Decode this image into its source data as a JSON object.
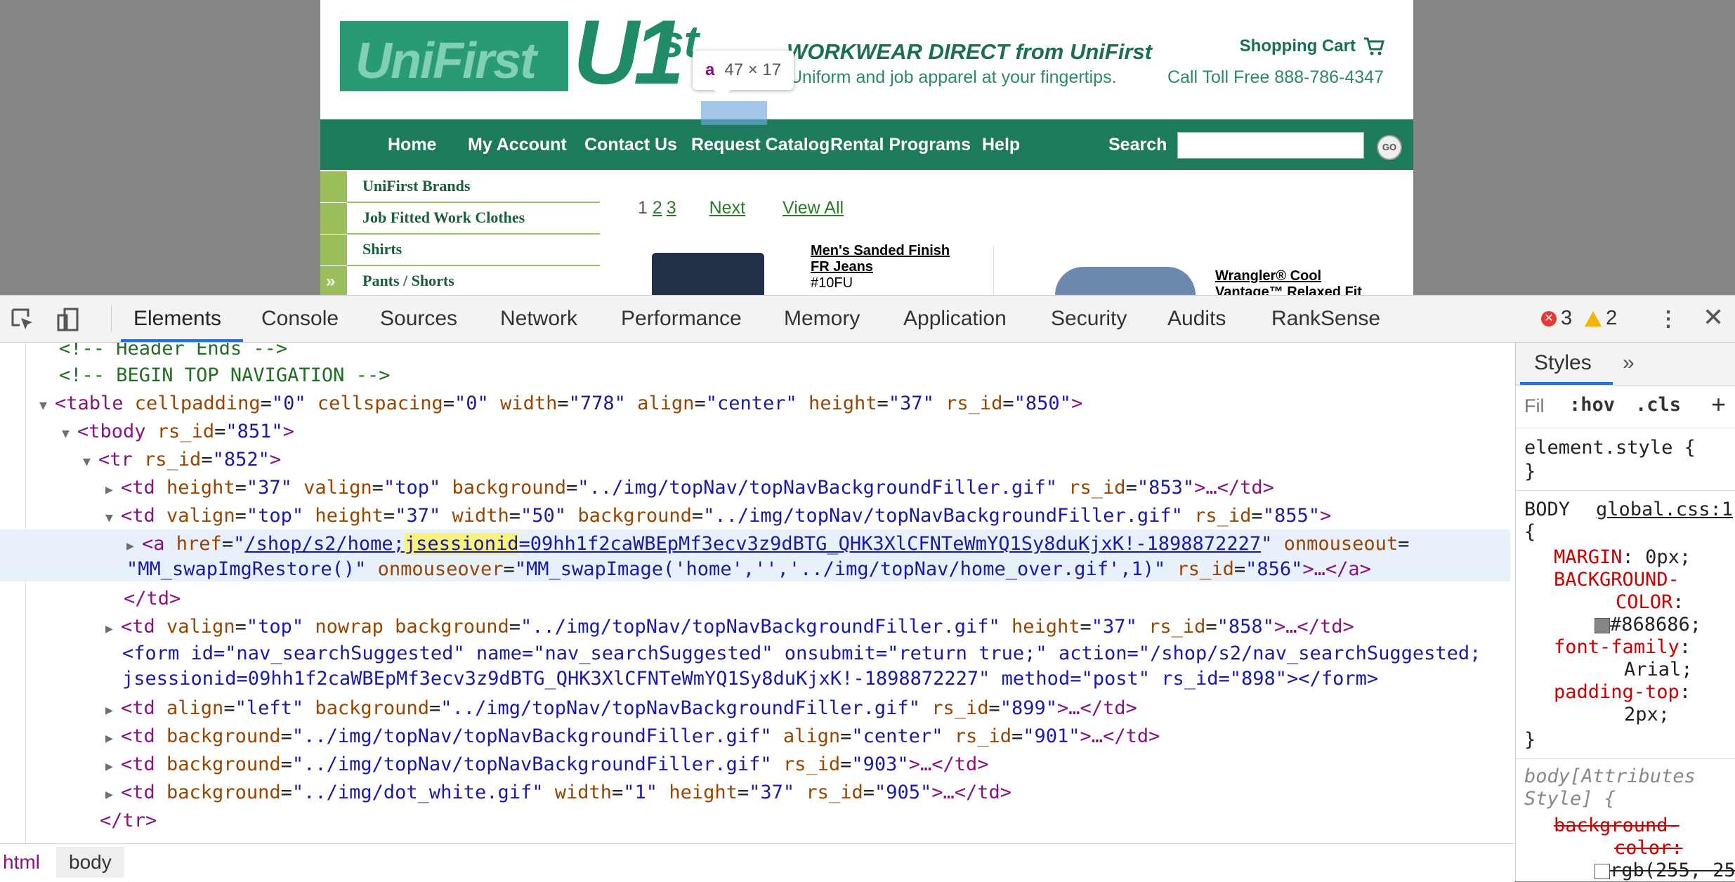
{
  "site": {
    "logo_left": "UniFirst",
    "logo_u1": "U1",
    "logo_st": "st",
    "tagline_title": "WORKWEAR DIRECT from UniFirst",
    "tagline_sub": "Uniform and job apparel at your fingertips.",
    "cart_label": "Shopping Cart",
    "toll_free": "Call Toll Free 888-786-4347",
    "nav": [
      "Home",
      "My Account",
      "Contact Us",
      "Request Catalog",
      "Rental Programs",
      "Help",
      "Search"
    ],
    "go_label": "GO",
    "sidebar": [
      "UniFirst Brands",
      "Job Fitted Work Clothes",
      "Shirts",
      "Pants / Shorts"
    ],
    "sidebar_arrow": "»",
    "pager": {
      "current": "1",
      "pages": [
        "2",
        "3"
      ],
      "next": "Next",
      "view_all": "View All"
    },
    "products": [
      {
        "title_line1": "Men's Sanded Finish",
        "title_line2": "FR Jeans",
        "code": "#10FU"
      },
      {
        "title_line1": "Wrangler® Cool",
        "title_line2": "Vantage™ Relaxed Fit"
      }
    ],
    "colors": {
      "nav_green": "#1e7a5d",
      "sidebar_tab": "#9bbf5a",
      "page_bg": "#868686"
    }
  },
  "inspect_tooltip": {
    "tag": "a",
    "dims": "47 × 17"
  },
  "devtools": {
    "tabs": [
      "Elements",
      "Console",
      "Sources",
      "Network",
      "Performance",
      "Memory",
      "Application",
      "Security",
      "Audits",
      "RankSense"
    ],
    "active_tab": "Elements",
    "errors": "3",
    "warnings": "2",
    "dom": {
      "l0": "<!-- Header Ends -->",
      "l1": "<!-- BEGIN TOP NAVIGATION -->",
      "l2": {
        "tag": "<table",
        "a": [
          [
            "cellpadding",
            "\"0\""
          ],
          [
            "cellspacing",
            "\"0\""
          ],
          [
            "width",
            "\"778\""
          ],
          [
            "align",
            "\"center\""
          ],
          [
            "height",
            "\"37\""
          ],
          [
            "rs_id",
            "\"850\""
          ]
        ]
      },
      "l3": {
        "tag": "<tbody",
        "a": [
          [
            "rs_id",
            "\"851\""
          ]
        ]
      },
      "l4": {
        "tag": "<tr",
        "a": [
          [
            "rs_id",
            "\"852\""
          ]
        ]
      },
      "l5": {
        "tag": "<td",
        "a": [
          [
            "height",
            "\"37\""
          ],
          [
            "valign",
            "\"top\""
          ],
          [
            "background",
            "\"../img/topNav/topNavBackgroundFiller.gif\""
          ],
          [
            "rs_id",
            "\"853\""
          ]
        ],
        "end": ">…</td>"
      },
      "l6": {
        "tag": "<td",
        "a": [
          [
            "valign",
            "\"top\""
          ],
          [
            "height",
            "\"37\""
          ],
          [
            "width",
            "\"50\""
          ],
          [
            "background",
            "\"../img/topNav/topNavBackgroundFiller.gif\""
          ],
          [
            "rs_id",
            "\"855\""
          ]
        ]
      },
      "l7_href_a": "/shop/s2/home;",
      "l7_href_mark": "jsessionid",
      "l7_href_b": "=09hh1f2caWBEpMf3ecv3z9dBTG_QHK3XlCFNTeWmYQ1Sy8duKjxK!-1898872227",
      "l7_onmouseout": "onmouseout",
      "l8_val1": "\"MM_swapImgRestore()\"",
      "l8_onmouseover": "onmouseover",
      "l8_val2": "\"MM_swapImage('home','','../img/topNav/home_over.gif',1)\"",
      "l8_rs": "\"856\"",
      "l9": "</td>",
      "l10": {
        "tag": "<td",
        "a": [
          [
            "valign",
            "\"top\""
          ],
          [
            "nowrap",
            ""
          ],
          [
            "background",
            "\"../img/topNav/topNavBackgroundFiller.gif\""
          ],
          [
            "height",
            "\"37\""
          ],
          [
            "rs_id",
            "\"858\""
          ]
        ],
        "end": ">…</td>"
      },
      "l11": "<form id=\"nav_searchSuggested\" name=\"nav_searchSuggested\" onsubmit=\"return true;\" action=\"/shop/s2/nav_searchSuggested;",
      "l12": "jsessionid=09hh1f2caWBEpMf3ecv3z9dBTG_QHK3XlCFNTeWmYQ1Sy8duKjxK!-1898872227\" method=\"post\" rs_id=\"898\"></form>",
      "l13": {
        "tag": "<td",
        "a": [
          [
            "align",
            "\"left\""
          ],
          [
            "background",
            "\"../img/topNav/topNavBackgroundFiller.gif\""
          ],
          [
            "rs_id",
            "\"899\""
          ]
        ],
        "end": ">…</td>"
      },
      "l14": {
        "tag": "<td",
        "a": [
          [
            "background",
            "\"../img/topNav/topNavBackgroundFiller.gif\""
          ],
          [
            "align",
            "\"center\""
          ],
          [
            "rs_id",
            "\"901\""
          ]
        ],
        "end": ">…</td>"
      },
      "l15": {
        "tag": "<td",
        "a": [
          [
            "background",
            "\"../img/topNav/topNavBackgroundFiller.gif\""
          ],
          [
            "rs_id",
            "\"903\""
          ]
        ],
        "end": ">…</td>"
      },
      "l16": {
        "tag": "<td",
        "a": [
          [
            "background",
            "\"../img/dot_white.gif\""
          ],
          [
            "width",
            "\"1\""
          ],
          [
            "height",
            "\"37\""
          ],
          [
            "rs_id",
            "\"905\""
          ]
        ],
        "end": ">…</td>"
      },
      "l17": "</tr>"
    },
    "breadcrumbs": [
      "html",
      "body"
    ],
    "styles": {
      "tab": "Styles",
      "more": "»",
      "filter_placeholder": "Fil",
      "hov": ":hov",
      "cls": ".cls",
      "element_style": "element.style {",
      "close_brace": "}",
      "body_selector": "BODY",
      "body_source": "global.css:1",
      "open_brace": "{",
      "props": [
        {
          "name": "MARGIN",
          "value": "0px;"
        },
        {
          "name": "BACKGROUND-",
          "name2": "COLOR",
          "value": "#868686;"
        },
        {
          "name": "font-family",
          "value": "Arial;"
        },
        {
          "name": "padding-top",
          "value": "2px;"
        }
      ],
      "attr_rule_1": "body[Attributes",
      "attr_rule_2": "Style] {",
      "attr_prop_1": "background-",
      "attr_prop_2": "color:",
      "attr_value": "rgb(255, 25"
    }
  }
}
